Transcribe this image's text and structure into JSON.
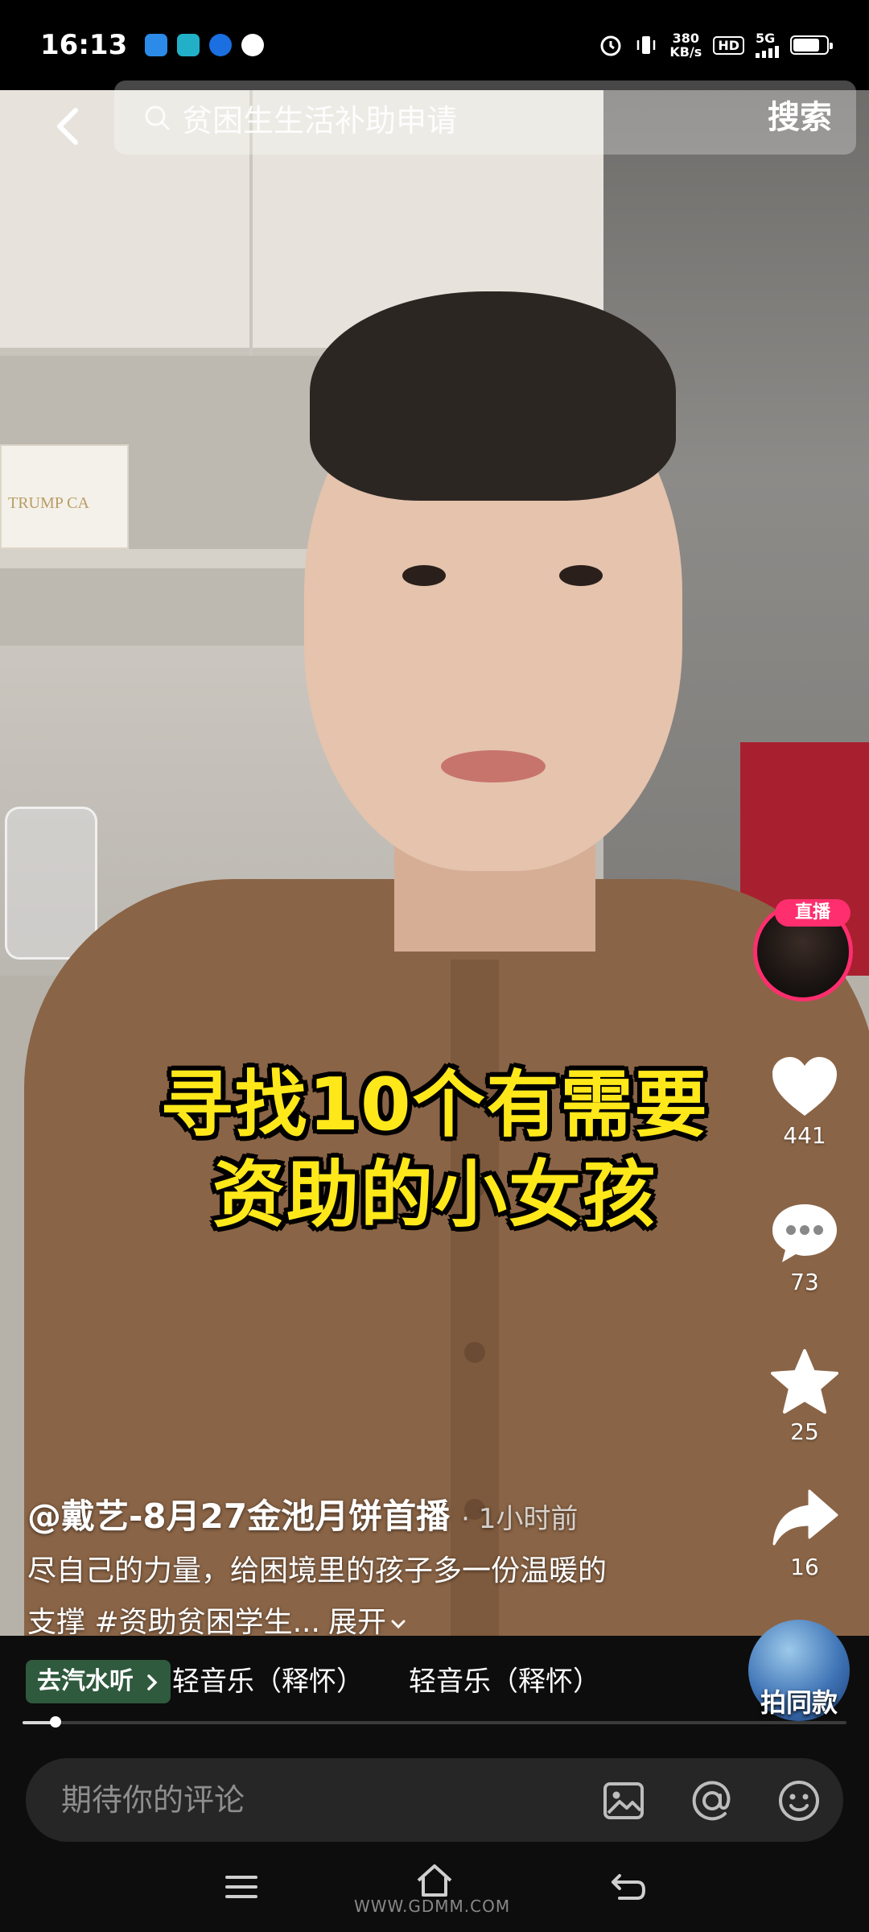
{
  "status_bar": {
    "time": "16:13",
    "net_speed_value": "380",
    "net_speed_unit": "KB/s",
    "hd": "HD",
    "network": "5G",
    "battery_level": 0.8
  },
  "search": {
    "query": "贫困生生活补助申请",
    "button_label": "搜索"
  },
  "video": {
    "caption_line1": "寻找10个有需要",
    "caption_line2": "资助的小女孩",
    "trump_box_text": "TRUMP CA"
  },
  "side_rail": {
    "live_badge": "直播",
    "likes": "441",
    "comments": "73",
    "favorites": "25",
    "shares": "16",
    "same_label": "拍同款"
  },
  "post": {
    "author": "@戴艺-8月27金池月饼首播",
    "time": "· 1小时前",
    "description_line1": "尽自己的力量，给困境里的孩子多一份温暖的",
    "description_line2": "支撑 #资助贫困学生...",
    "expand_label": "展开"
  },
  "music": {
    "tag_label": "去汽水听",
    "track1": "轻音乐（释怀）",
    "track2": "轻音乐（释怀）",
    "progress": 0.04
  },
  "comment": {
    "placeholder": "期待你的评论"
  },
  "watermark": "WWW.GDMM.COM",
  "colors": {
    "accent_live": "#ff2e6e",
    "caption_text": "#ffe81a",
    "music_tag": "#2f5a3e"
  }
}
